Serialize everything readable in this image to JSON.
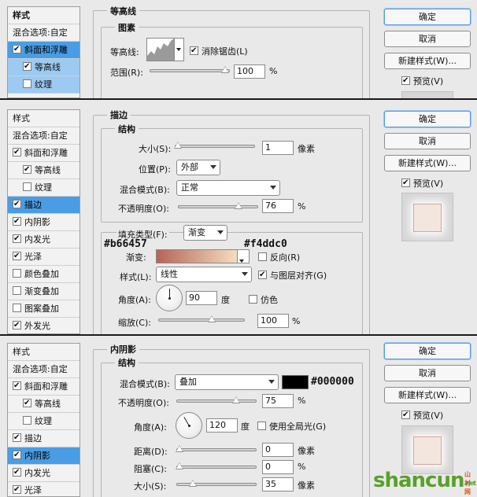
{
  "panel1": {
    "styles_header": "样式",
    "blend_options": "混合选项:自定",
    "items": [
      {
        "label": "斜面和浮雕",
        "checked": true
      },
      {
        "label": "等高线",
        "checked": true
      },
      {
        "label": "纹理",
        "checked": false
      }
    ],
    "section_title": "等高线",
    "group_title": "图素",
    "contour_label": "等高线:",
    "antialias_label": "消除锯齿(L)",
    "range_label": "范围(R):",
    "range_value": "100",
    "range_unit": "%",
    "range_level": 0.95
  },
  "panel2": {
    "styles_header": "样式",
    "blend_options": "混合选项:自定",
    "items": [
      {
        "label": "斜面和浮雕",
        "checked": true
      },
      {
        "label": "等高线",
        "checked": true
      },
      {
        "label": "纹理",
        "checked": false
      },
      {
        "label": "描边",
        "checked": true
      },
      {
        "label": "内阴影",
        "checked": true
      },
      {
        "label": "内发光",
        "checked": true
      },
      {
        "label": "光泽",
        "checked": true
      },
      {
        "label": "颜色叠加",
        "checked": false
      },
      {
        "label": "渐变叠加",
        "checked": false
      },
      {
        "label": "图案叠加",
        "checked": false
      },
      {
        "label": "外发光",
        "checked": true
      }
    ],
    "section_title": "描边",
    "group_title": "结构",
    "size_label": "大小(S):",
    "size_value": "1",
    "size_unit": "像素",
    "position_label": "位置(P):",
    "position_value": "外部",
    "blend_label": "混合模式(B):",
    "blend_value": "正常",
    "opacity_label": "不透明度(O):",
    "opacity_value": "76",
    "opacity_unit": "%",
    "fill_type_label": "填充类型(F):",
    "fill_type_value": "渐变",
    "gradient_start_hex": "#b66457",
    "gradient_end_hex": "#f4ddc0",
    "gradient_label": "渐变:",
    "reverse_label": "反向(R)",
    "style_label": "样式(L):",
    "style_value": "线性",
    "align_label": "与图层对齐(G)",
    "angle_label": "角度(A):",
    "angle_value": "90",
    "angle_unit": "度",
    "dither_label": "仿色",
    "scale_label": "缩放(C):",
    "scale_value": "100",
    "scale_unit": "%"
  },
  "panel3": {
    "styles_header": "样式",
    "blend_options": "混合选项:自定",
    "items": [
      {
        "label": "斜面和浮雕",
        "checked": true
      },
      {
        "label": "等高线",
        "checked": true
      },
      {
        "label": "纹理",
        "checked": false
      },
      {
        "label": "描边",
        "checked": true
      },
      {
        "label": "内阴影",
        "checked": true
      },
      {
        "label": "内发光",
        "checked": true
      },
      {
        "label": "光泽",
        "checked": true
      }
    ],
    "section_title": "内阴影",
    "group_title": "结构",
    "blend_label": "混合模式(B):",
    "blend_value": "叠加",
    "color_hex": "#000000",
    "opacity_label": "不透明度(O):",
    "opacity_value": "75",
    "opacity_unit": "%",
    "angle_label": "角度(A):",
    "angle_value": "120",
    "angle_unit": "度",
    "global_light_label": "使用全局光(G)",
    "distance_label": "距离(D):",
    "distance_value": "0",
    "distance_unit": "像素",
    "choke_label": "阻塞(C):",
    "choke_value": "0",
    "choke_unit": "%",
    "size_label": "大小(S):",
    "size_value": "35",
    "size_unit": "像素"
  },
  "buttons": {
    "ok": "确定",
    "cancel": "取消",
    "new_style": "新建样式(W)...",
    "preview": "预览(V)"
  },
  "watermark": {
    "text_main": "shancun",
    "text_small": "山村网",
    "text_sub": ".net"
  },
  "colors": {
    "selected_blue": "#4a9de4",
    "accent_green": "#5aa02c",
    "accent_orange": "#e2561d"
  }
}
